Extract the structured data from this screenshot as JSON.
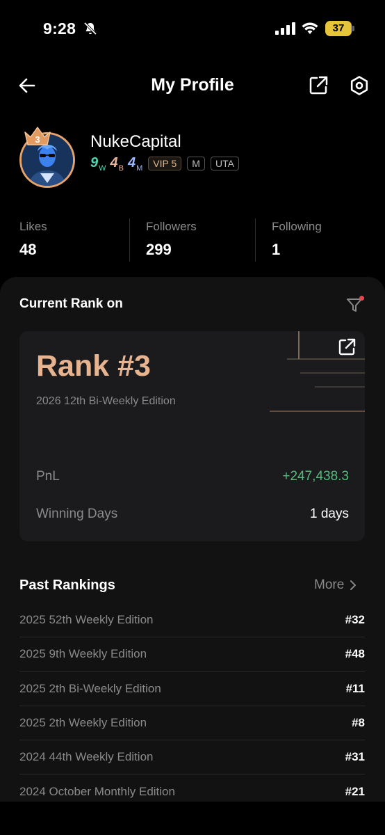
{
  "status_bar": {
    "time": "9:28",
    "battery": "37"
  },
  "header": {
    "title": "My Profile"
  },
  "profile": {
    "username": "NukeCapital",
    "crown_rank": "3",
    "badges": {
      "weekly": {
        "num": "9",
        "sub": "W"
      },
      "biweekly": {
        "num": "4",
        "sub": "B"
      },
      "monthly": {
        "num": "4",
        "sub": "M"
      }
    },
    "vip": "VIP 5",
    "tags": [
      "M",
      "UTA"
    ]
  },
  "stats": [
    {
      "label": "Likes",
      "value": "48"
    },
    {
      "label": "Followers",
      "value": "299"
    },
    {
      "label": "Following",
      "value": "1"
    }
  ],
  "current_rank": {
    "heading": "Current Rank on",
    "rank": "Rank #3",
    "edition": "2026 12th Bi-Weekly Edition",
    "pnl_label": "PnL",
    "pnl_value": "+247,438.3",
    "winning_label": "Winning Days",
    "winning_value": "1 days"
  },
  "past_rankings": {
    "title": "Past Rankings",
    "more": "More",
    "rows": [
      {
        "edition": "2025 52th Weekly Edition",
        "rank": "#32"
      },
      {
        "edition": "2025 9th Weekly Edition",
        "rank": "#48"
      },
      {
        "edition": "2025 2th Bi-Weekly Edition",
        "rank": "#11"
      },
      {
        "edition": "2025 2th Weekly Edition",
        "rank": "#8"
      },
      {
        "edition": "2024 44th Weekly Edition",
        "rank": "#31"
      },
      {
        "edition": "2024 October Monthly Edition",
        "rank": "#21"
      }
    ]
  },
  "colors": {
    "accent": "#e7b48f",
    "positive": "#4fbf7b",
    "notification": "#e5484d"
  }
}
